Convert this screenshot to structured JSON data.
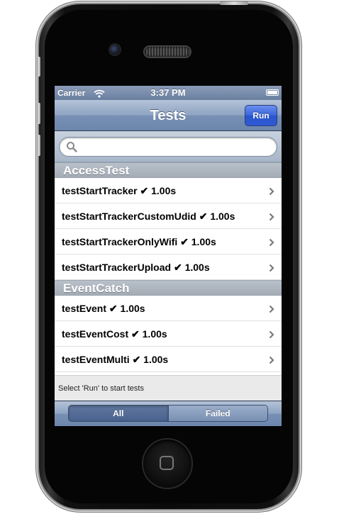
{
  "status_bar": {
    "carrier": "Carrier",
    "time": "3:37 PM",
    "wifi_icon": "wifi-icon",
    "battery_icon": "battery-icon"
  },
  "nav": {
    "title": "Tests",
    "run_label": "Run"
  },
  "search": {
    "placeholder": "",
    "icon": "search-icon"
  },
  "sections": [
    {
      "title": "AccessTest",
      "rows": [
        "testStartTracker ✔ 1.00s",
        "testStartTrackerCustomUdid ✔ 1.00s",
        "testStartTrackerOnlyWifi ✔ 1.00s",
        "testStartTrackerUpload ✔ 1.00s"
      ]
    },
    {
      "title": "EventCatch",
      "rows": [
        "testEvent ✔ 1.00s",
        "testEventCost ✔ 1.00s",
        "testEventMulti ✔ 1.00s"
      ]
    }
  ],
  "footer": {
    "status_text": "Select 'Run' to start tests"
  },
  "toolbar": {
    "segments": [
      "All",
      "Failed"
    ],
    "selected": "All"
  },
  "colors": {
    "nav_blue": "#7890b4",
    "run_button_blue": "#3a64d8",
    "section_header_gray": "#a4acb6"
  }
}
